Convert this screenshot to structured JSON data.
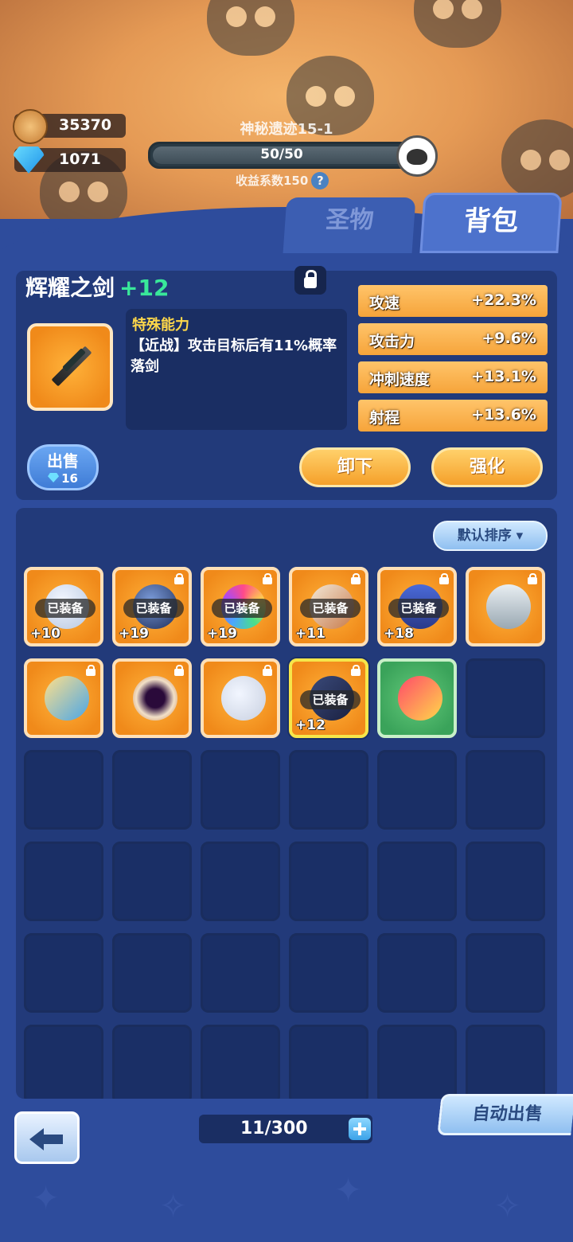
{
  "hud": {
    "coins": "35370",
    "gems": "1071",
    "stage_name": "神秘遗迹15-1",
    "progress_text": "50/50",
    "progress_fraction": 1.0,
    "income_text": "收益系数150",
    "help_icon": "?"
  },
  "tabs": [
    {
      "label": "圣物",
      "active": false
    },
    {
      "label": "背包",
      "active": true
    }
  ],
  "selected_item": {
    "name": "辉耀之剑",
    "level": "+12",
    "ability_title": "特殊能力",
    "ability_text": "【近战】攻击目标后有11%概率落剑",
    "stats": [
      {
        "name": "攻速",
        "value": "+22.3%"
      },
      {
        "name": "攻击力",
        "value": "+9.6%"
      },
      {
        "name": "冲刺速度",
        "value": "+13.1%"
      },
      {
        "name": "射程",
        "value": "+13.6%"
      }
    ],
    "sell_label": "出售",
    "sell_price": "16",
    "unequip_label": "卸下",
    "upgrade_label": "强化"
  },
  "bag": {
    "sort_label": "默认排序",
    "equipped_label": "已装备",
    "slots": [
      {
        "type": "orange",
        "art": "balloon-icon",
        "equipped": true,
        "level": "+10",
        "locked": false
      },
      {
        "type": "orange",
        "art": "crystal-ball-icon",
        "equipped": true,
        "level": "+19",
        "locked": true
      },
      {
        "type": "orange",
        "art": "rainbow-orb-icon",
        "equipped": true,
        "level": "+19",
        "locked": true
      },
      {
        "type": "orange",
        "art": "war-fan-icon",
        "equipped": true,
        "level": "+11",
        "locked": true
      },
      {
        "type": "orange",
        "art": "suit-jacket-icon",
        "equipped": true,
        "level": "+18",
        "locked": true
      },
      {
        "type": "orange",
        "art": "tornado-icon",
        "equipped": false,
        "level": "",
        "locked": true
      },
      {
        "type": "orange",
        "art": "rocket-icon",
        "equipped": false,
        "level": "",
        "locked": true
      },
      {
        "type": "orange",
        "art": "black-hole-icon",
        "equipped": false,
        "level": "",
        "locked": true
      },
      {
        "type": "orange",
        "art": "megaphone-icon",
        "equipped": false,
        "level": "",
        "locked": true
      },
      {
        "type": "orange",
        "art": "sword-icon",
        "equipped": true,
        "level": "+12",
        "locked": true,
        "selected": true
      },
      {
        "type": "green",
        "art": "party-popper-icon",
        "equipped": false,
        "level": "",
        "locked": false
      }
    ],
    "capacity": "11/300",
    "auto_sell_label": "自动出售"
  },
  "colors": {
    "panel": "#223a7a",
    "background": "#2e4c9c",
    "level_green": "#39e89a",
    "ability_yellow": "#ffd84a",
    "stat_orange": "#f6a43a"
  }
}
